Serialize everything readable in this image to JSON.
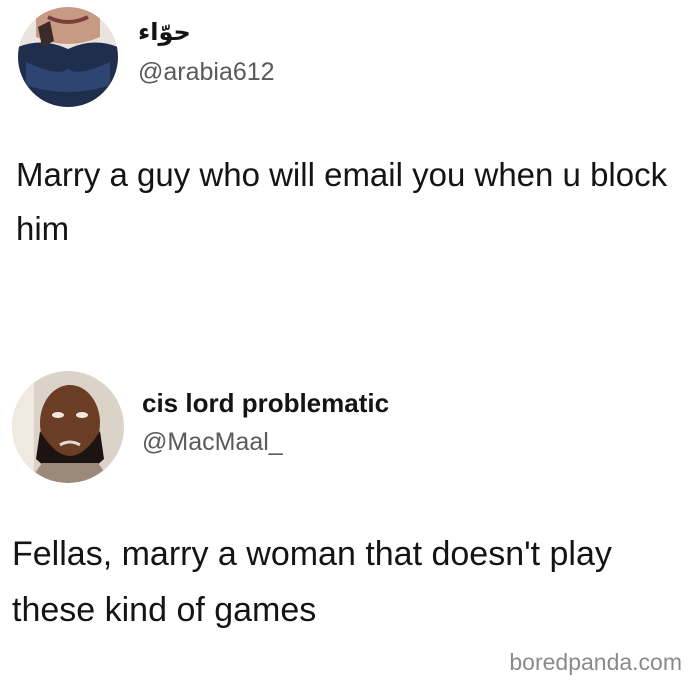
{
  "tweets": [
    {
      "display_name": "حوّاء",
      "handle": "@arabia612",
      "text": "Marry a guy who will email you when u block him"
    },
    {
      "display_name": "cis lord problematic",
      "handle": "@MacMaal_",
      "text": "Fellas, marry a woman that doesn't play these kind of games"
    }
  ],
  "watermark": "boredpanda.com"
}
